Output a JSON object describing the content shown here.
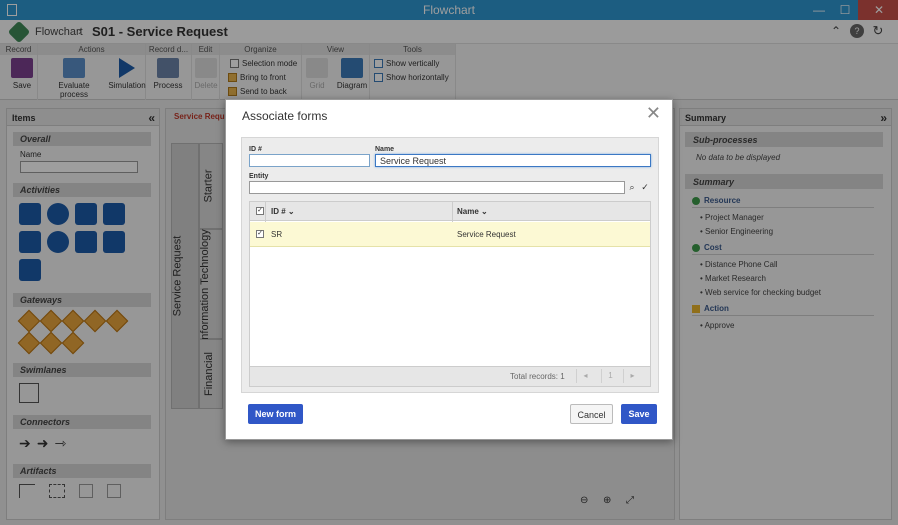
{
  "window": {
    "title": "Flowchart",
    "minimize": "—",
    "maximize": "☐",
    "close": "✕"
  },
  "header": {
    "breadcrumb_root": "Flowchart",
    "breadcrumb_sep": "›",
    "breadcrumb_current": "S01 - Service Request",
    "up_icon": "⌃",
    "help_icon": "?",
    "refresh_icon": "↻"
  },
  "ribbon": {
    "groups": {
      "record": "Record",
      "actions": "Actions",
      "record_d": "Record d...",
      "edit": "Edit",
      "organize": "Organize",
      "view": "View",
      "tools": "Tools"
    },
    "save": "Save",
    "evaluate": "Evaluate process",
    "simulation": "Simulation",
    "process": "Process",
    "delete": "Delete",
    "selection_mode": "Selection mode",
    "bring_front": "Bring to front",
    "send_back": "Send to back",
    "grid": "Grid",
    "diagram": "Diagram",
    "show_vertically": "Show vertically",
    "show_horizontally": "Show horizontally"
  },
  "left": {
    "title": "Items",
    "collapse": "«",
    "overall": "Overall",
    "name_label": "Name",
    "activities": "Activities",
    "gateways": "Gateways",
    "swimlanes": "Swimlanes",
    "connectors": "Connectors",
    "artifacts": "Artifacts"
  },
  "canvas": {
    "tab": "Service Request",
    "pool": "Service Request",
    "lanes": [
      "Starter",
      "Information Technology",
      "Financial"
    ]
  },
  "right": {
    "title": "Summary",
    "collapse": "»",
    "subprocesses": "Sub-processes",
    "no_data": "No data to be displayed",
    "summary": "Summary",
    "resource": "Resource",
    "resources": [
      "Project Manager",
      "Senior Engineering"
    ],
    "cost": "Cost",
    "costs": [
      "Distance Phone Call",
      "Market Research",
      "Web service for checking budget"
    ],
    "action": "Action",
    "actions": [
      "Approve"
    ]
  },
  "dialog": {
    "title": "Associate forms",
    "close": "✕",
    "id_label": "ID #",
    "id_value": "",
    "name_label": "Name",
    "name_value": "Service Request",
    "entity_label": "Entity",
    "entity_value": "",
    "search_icon": "⌕",
    "clear_icon": "✓",
    "grid": {
      "col_id": "ID #",
      "col_name": "Name",
      "rows": [
        {
          "id": "SR",
          "name": "Service Request",
          "checked": true
        }
      ],
      "total": "Total records: 1",
      "page": "1"
    },
    "new_form": "New form",
    "cancel": "Cancel",
    "save": "Save"
  },
  "colors": {
    "titlebar": "#2e96d1",
    "primary": "#3057c7",
    "selected_row": "#fcf9d4",
    "close": "#c7504a"
  }
}
